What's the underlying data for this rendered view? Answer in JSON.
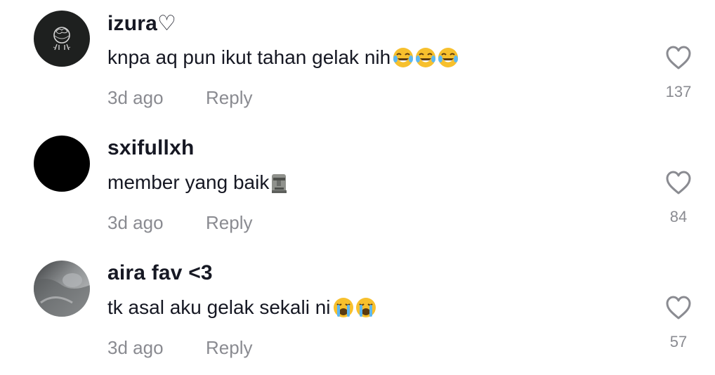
{
  "comments": [
    {
      "username": "izura♡",
      "text": "knpa aq pun ikut tahan gelak nih",
      "emojis": [
        "face-with-tears-of-joy",
        "face-with-tears-of-joy",
        "face-with-tears-of-joy"
      ],
      "time": "3d ago",
      "reply_label": "Reply",
      "likes": "137",
      "avatar": "dark-sketch"
    },
    {
      "username": "sxifullxh",
      "text": "member yang baik",
      "emojis": [
        "moai"
      ],
      "time": "3d ago",
      "reply_label": "Reply",
      "likes": "84",
      "avatar": "black-circle"
    },
    {
      "username": "aira fav <3",
      "text": "tk asal aku gelak sekali ni ",
      "emojis": [
        "loudly-crying-face",
        "loudly-crying-face"
      ],
      "time": "3d ago",
      "reply_label": "Reply",
      "likes": "57",
      "avatar": "grey-photo"
    }
  ],
  "colors": {
    "username": "#161823",
    "secondary": "#8a8b91",
    "heart_outline": "#8a8b91"
  }
}
